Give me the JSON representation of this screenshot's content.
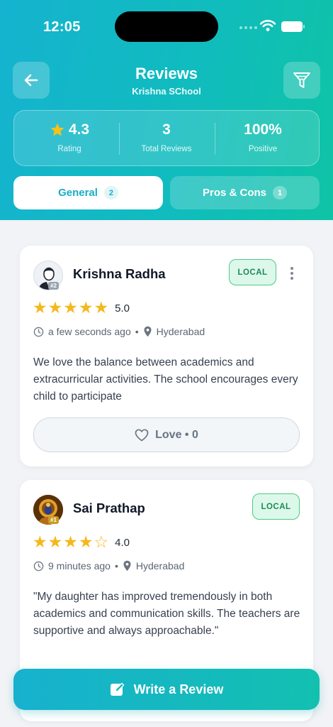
{
  "status": {
    "time": "12:05"
  },
  "header": {
    "title": "Reviews",
    "subtitle": "Krishna SChool"
  },
  "stats": [
    {
      "value": "4.3",
      "label": "Rating",
      "icon": "star-icon"
    },
    {
      "value": "3",
      "label": "Total Reviews"
    },
    {
      "value": "100%",
      "label": "Positive"
    }
  ],
  "tabs": [
    {
      "label": "General",
      "count": "2",
      "active": true
    },
    {
      "label": "Pros & Cons",
      "count": "1",
      "active": false
    }
  ],
  "reviews": [
    {
      "name": "Krishna Radha",
      "rank": "#2",
      "badge": "LOCAL",
      "stars": 5,
      "rating": "5.0",
      "time": "a few seconds ago",
      "location": "Hyderabad",
      "text": "We love the balance between academics and extracurricular activities. The school encourages every child to participate",
      "love_label": "Love • 0"
    },
    {
      "name": "Sai Prathap",
      "rank": "#1",
      "badge": "LOCAL",
      "stars": 4,
      "rating": "4.0",
      "time": "9 minutes ago",
      "location": "Hyderabad",
      "text": "\"My daughter has improved tremendously in both academics and communication skills. The teachers are supportive and always approachable.\""
    }
  ],
  "write_button": {
    "label": "Write a Review"
  },
  "colors": {
    "accent": "#15b3cf",
    "accent_end": "#0fc3a6",
    "star": "#f5b81c",
    "local_badge": "#4fc985"
  }
}
